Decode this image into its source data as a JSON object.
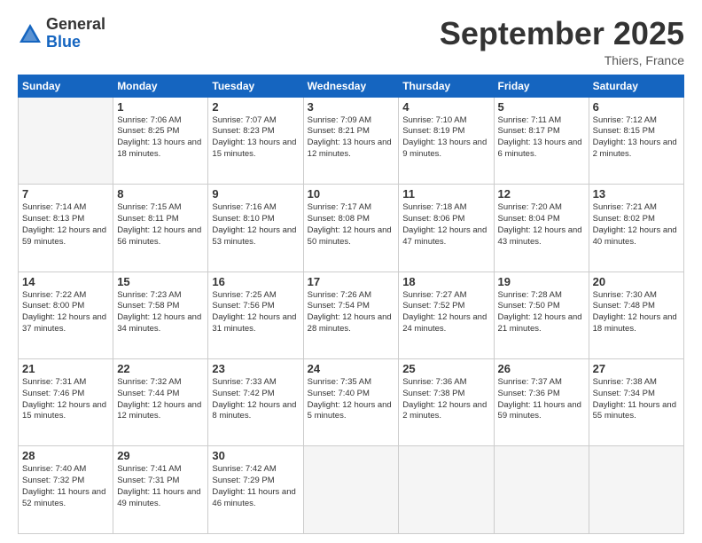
{
  "header": {
    "logo_general": "General",
    "logo_blue": "Blue",
    "month_title": "September 2025",
    "location": "Thiers, France"
  },
  "weekdays": [
    "Sunday",
    "Monday",
    "Tuesday",
    "Wednesday",
    "Thursday",
    "Friday",
    "Saturday"
  ],
  "weeks": [
    [
      {
        "day": null
      },
      {
        "day": "1",
        "sunrise": "7:06 AM",
        "sunset": "8:25 PM",
        "daylight": "13 hours and 18 minutes."
      },
      {
        "day": "2",
        "sunrise": "7:07 AM",
        "sunset": "8:23 PM",
        "daylight": "13 hours and 15 minutes."
      },
      {
        "day": "3",
        "sunrise": "7:09 AM",
        "sunset": "8:21 PM",
        "daylight": "13 hours and 12 minutes."
      },
      {
        "day": "4",
        "sunrise": "7:10 AM",
        "sunset": "8:19 PM",
        "daylight": "13 hours and 9 minutes."
      },
      {
        "day": "5",
        "sunrise": "7:11 AM",
        "sunset": "8:17 PM",
        "daylight": "13 hours and 6 minutes."
      },
      {
        "day": "6",
        "sunrise": "7:12 AM",
        "sunset": "8:15 PM",
        "daylight": "13 hours and 2 minutes."
      }
    ],
    [
      {
        "day": "7",
        "sunrise": "7:14 AM",
        "sunset": "8:13 PM",
        "daylight": "12 hours and 59 minutes."
      },
      {
        "day": "8",
        "sunrise": "7:15 AM",
        "sunset": "8:11 PM",
        "daylight": "12 hours and 56 minutes."
      },
      {
        "day": "9",
        "sunrise": "7:16 AM",
        "sunset": "8:10 PM",
        "daylight": "12 hours and 53 minutes."
      },
      {
        "day": "10",
        "sunrise": "7:17 AM",
        "sunset": "8:08 PM",
        "daylight": "12 hours and 50 minutes."
      },
      {
        "day": "11",
        "sunrise": "7:18 AM",
        "sunset": "8:06 PM",
        "daylight": "12 hours and 47 minutes."
      },
      {
        "day": "12",
        "sunrise": "7:20 AM",
        "sunset": "8:04 PM",
        "daylight": "12 hours and 43 minutes."
      },
      {
        "day": "13",
        "sunrise": "7:21 AM",
        "sunset": "8:02 PM",
        "daylight": "12 hours and 40 minutes."
      }
    ],
    [
      {
        "day": "14",
        "sunrise": "7:22 AM",
        "sunset": "8:00 PM",
        "daylight": "12 hours and 37 minutes."
      },
      {
        "day": "15",
        "sunrise": "7:23 AM",
        "sunset": "7:58 PM",
        "daylight": "12 hours and 34 minutes."
      },
      {
        "day": "16",
        "sunrise": "7:25 AM",
        "sunset": "7:56 PM",
        "daylight": "12 hours and 31 minutes."
      },
      {
        "day": "17",
        "sunrise": "7:26 AM",
        "sunset": "7:54 PM",
        "daylight": "12 hours and 28 minutes."
      },
      {
        "day": "18",
        "sunrise": "7:27 AM",
        "sunset": "7:52 PM",
        "daylight": "12 hours and 24 minutes."
      },
      {
        "day": "19",
        "sunrise": "7:28 AM",
        "sunset": "7:50 PM",
        "daylight": "12 hours and 21 minutes."
      },
      {
        "day": "20",
        "sunrise": "7:30 AM",
        "sunset": "7:48 PM",
        "daylight": "12 hours and 18 minutes."
      }
    ],
    [
      {
        "day": "21",
        "sunrise": "7:31 AM",
        "sunset": "7:46 PM",
        "daylight": "12 hours and 15 minutes."
      },
      {
        "day": "22",
        "sunrise": "7:32 AM",
        "sunset": "7:44 PM",
        "daylight": "12 hours and 12 minutes."
      },
      {
        "day": "23",
        "sunrise": "7:33 AM",
        "sunset": "7:42 PM",
        "daylight": "12 hours and 8 minutes."
      },
      {
        "day": "24",
        "sunrise": "7:35 AM",
        "sunset": "7:40 PM",
        "daylight": "12 hours and 5 minutes."
      },
      {
        "day": "25",
        "sunrise": "7:36 AM",
        "sunset": "7:38 PM",
        "daylight": "12 hours and 2 minutes."
      },
      {
        "day": "26",
        "sunrise": "7:37 AM",
        "sunset": "7:36 PM",
        "daylight": "11 hours and 59 minutes."
      },
      {
        "day": "27",
        "sunrise": "7:38 AM",
        "sunset": "7:34 PM",
        "daylight": "11 hours and 55 minutes."
      }
    ],
    [
      {
        "day": "28",
        "sunrise": "7:40 AM",
        "sunset": "7:32 PM",
        "daylight": "11 hours and 52 minutes."
      },
      {
        "day": "29",
        "sunrise": "7:41 AM",
        "sunset": "7:31 PM",
        "daylight": "11 hours and 49 minutes."
      },
      {
        "day": "30",
        "sunrise": "7:42 AM",
        "sunset": "7:29 PM",
        "daylight": "11 hours and 46 minutes."
      },
      {
        "day": null
      },
      {
        "day": null
      },
      {
        "day": null
      },
      {
        "day": null
      }
    ]
  ]
}
